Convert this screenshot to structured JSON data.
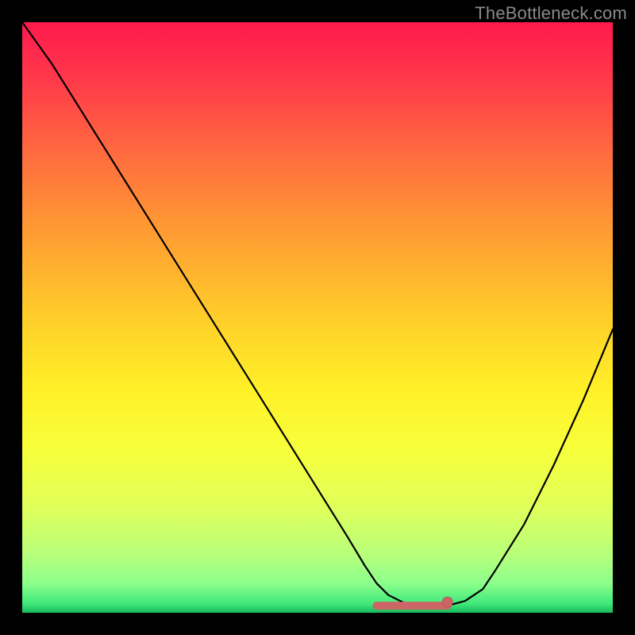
{
  "watermark": "TheBottleneck.com",
  "colors": {
    "frame": "#000000",
    "curve": "#000000",
    "marker_fill": "#cc6666",
    "marker_stroke": "#b85555",
    "gradient_stops": [
      {
        "offset": 0.0,
        "color": "#ff1a4d"
      },
      {
        "offset": 0.1,
        "color": "#ff3a4a"
      },
      {
        "offset": 0.22,
        "color": "#ff6a3f"
      },
      {
        "offset": 0.35,
        "color": "#ff9a33"
      },
      {
        "offset": 0.5,
        "color": "#ffce2a"
      },
      {
        "offset": 0.62,
        "color": "#fff028"
      },
      {
        "offset": 0.72,
        "color": "#f7ff3a"
      },
      {
        "offset": 0.82,
        "color": "#e0ff5a"
      },
      {
        "offset": 0.9,
        "color": "#b8ff7a"
      },
      {
        "offset": 0.95,
        "color": "#8cff8c"
      },
      {
        "offset": 0.985,
        "color": "#40e87a"
      },
      {
        "offset": 1.0,
        "color": "#16b85a"
      }
    ]
  },
  "chart_data": {
    "type": "line",
    "title": "",
    "xlabel": "",
    "ylabel": "",
    "xlim": [
      0,
      100
    ],
    "ylim": [
      0,
      100
    ],
    "series": [
      {
        "name": "bottleneck-curve",
        "x": [
          0,
          5,
          10,
          15,
          20,
          25,
          30,
          35,
          40,
          45,
          50,
          55,
          58,
          60,
          62,
          65,
          68,
          70,
          72,
          75,
          78,
          80,
          85,
          90,
          95,
          100
        ],
        "y": [
          100,
          93,
          85,
          77,
          69,
          61,
          53,
          45,
          37,
          29,
          21,
          13,
          8,
          5,
          3,
          1.5,
          1,
          1,
          1.2,
          2,
          4,
          7,
          15,
          25,
          36,
          48
        ]
      }
    ],
    "flat_region": {
      "x_start": 60,
      "x_end": 72,
      "y": 1.2
    },
    "marker": {
      "x": 72,
      "y": 1.8
    }
  }
}
